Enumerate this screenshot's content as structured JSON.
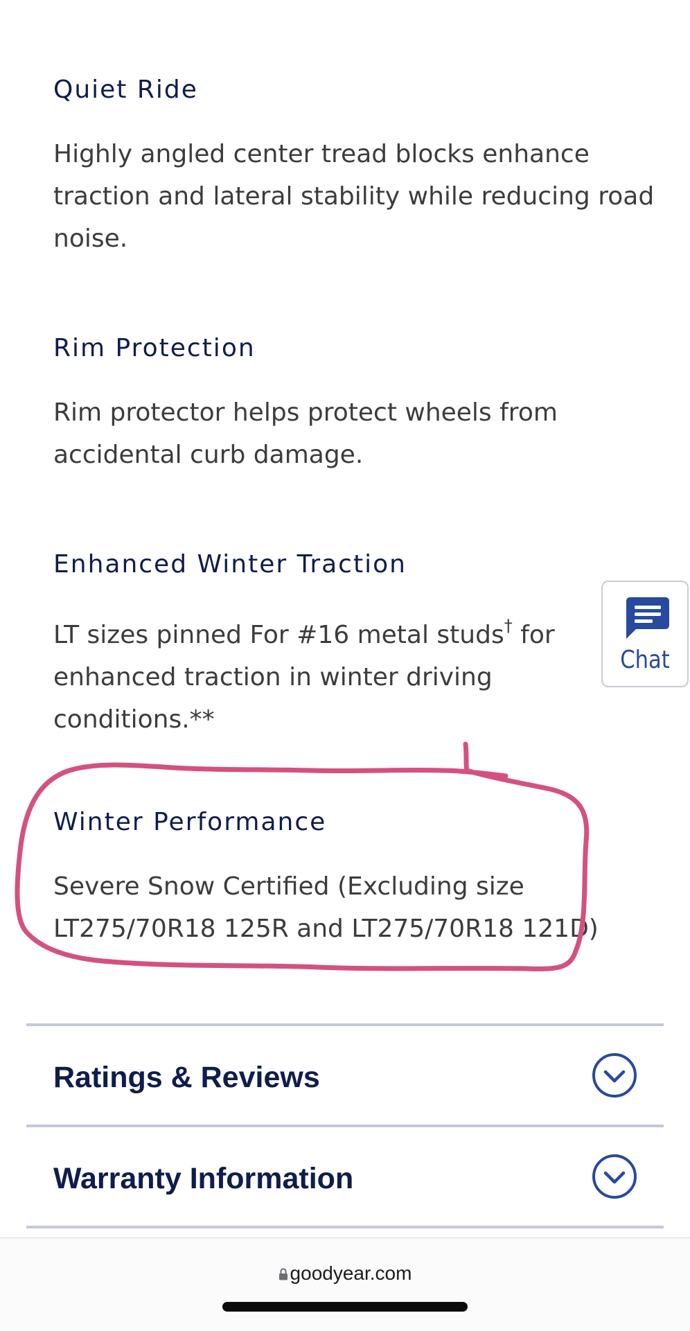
{
  "features": [
    {
      "title": "Quiet Ride",
      "description": [
        "Highly angled center tread blocks enhance",
        "traction and lateral stability while reducing road",
        "noise."
      ]
    },
    {
      "title": "Rim Protection",
      "description": [
        "Rim protector helps protect wheels from",
        "accidental curb damage."
      ]
    },
    {
      "title": "Enhanced Winter Traction",
      "description_line1_before": "LT sizes pinned For #16 metal studs",
      "description_line1_superscript": "†",
      "description_line1_after": " for",
      "description_line2": "enhanced traction in winter driving",
      "description_line3": "conditions.**"
    },
    {
      "title": "Winter Performance",
      "description": [
        "Severe Snow Certified (Excluding size",
        "LT275/70R18 125R and LT275/70R18 121D)"
      ]
    }
  ],
  "chat_widget": {
    "label": "Chat",
    "icon": "chat-bubble-icon",
    "color": "#274a9e"
  },
  "accordions": [
    {
      "label": "Ratings & Reviews",
      "icon": "chevron-down-circle-icon"
    },
    {
      "label": "Warranty Information",
      "icon": "chevron-down-circle-icon"
    }
  ],
  "browser": {
    "url": "goodyear.com",
    "icon": "lock-icon"
  },
  "annotation": {
    "type": "hand-drawn-circle",
    "color": "#d4517f"
  },
  "colors": {
    "heading": "#0f1c4d",
    "body_text": "#3c3c3c",
    "accent_blue": "#274a9e",
    "divider": "#c3c9d8"
  }
}
